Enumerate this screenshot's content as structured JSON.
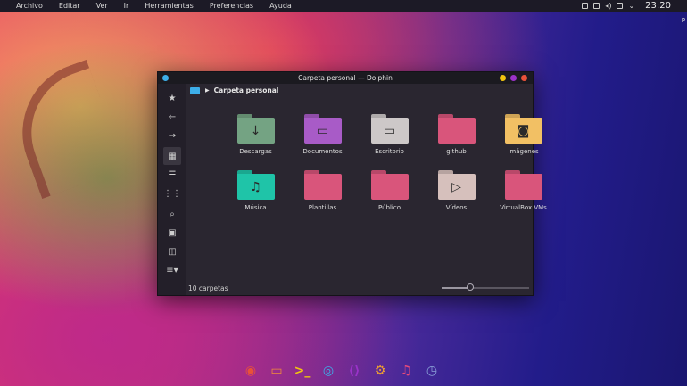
{
  "menubar": {
    "items": [
      "Archivo",
      "Editar",
      "Ver",
      "Ir",
      "Herramientas",
      "Preferencias",
      "Ayuda"
    ],
    "clock": "23:20"
  },
  "edge_text": "P",
  "window": {
    "title": "Carpeta personal — Dolphin",
    "controls": [
      {
        "name": "minimize",
        "color": "#f1c40f"
      },
      {
        "name": "maximize",
        "color": "#9b32c9"
      },
      {
        "name": "close",
        "color": "#e8513a"
      }
    ],
    "breadcrumb": "Carpeta personal",
    "sidebar": [
      {
        "name": "favorites",
        "glyph": "★"
      },
      {
        "name": "back",
        "glyph": "←"
      },
      {
        "name": "forward",
        "glyph": "→"
      },
      {
        "name": "icons-view",
        "glyph": "▦",
        "active": true
      },
      {
        "name": "compact-view",
        "glyph": "☰"
      },
      {
        "name": "details-view",
        "glyph": "⋮⋮"
      },
      {
        "name": "search",
        "glyph": "⌕"
      },
      {
        "name": "preview",
        "glyph": "▣"
      },
      {
        "name": "split",
        "glyph": "◫"
      },
      {
        "name": "menu",
        "glyph": "≡▾"
      }
    ],
    "folders": [
      {
        "label": "Descargas",
        "color": "#74a383",
        "glyph": "↓"
      },
      {
        "label": "Documentos",
        "color": "#a85bc7",
        "glyph": "▭"
      },
      {
        "label": "Escritorio",
        "color": "#cdc8c8",
        "glyph": "▭"
      },
      {
        "label": "github",
        "color": "#d9557b",
        "glyph": ""
      },
      {
        "label": "Imágenes",
        "color": "#f2c064",
        "glyph": "◙"
      },
      {
        "label": "Música",
        "color": "#1fc4a8",
        "glyph": "♫"
      },
      {
        "label": "Plantillas",
        "color": "#d9557b",
        "glyph": ""
      },
      {
        "label": "Público",
        "color": "#d9557b",
        "glyph": ""
      },
      {
        "label": "Vídeos",
        "color": "#d6c0bc",
        "glyph": "▷"
      },
      {
        "label": "VirtualBox VMs",
        "color": "#d9557b",
        "glyph": ""
      }
    ],
    "status": "10 carpetas",
    "zoom_fraction": 0.33
  },
  "dock": [
    {
      "name": "firefox-icon",
      "glyph": "◉",
      "color": "#e8513a"
    },
    {
      "name": "files-icon",
      "glyph": "▭",
      "color": "#f08a3a"
    },
    {
      "name": "terminal-icon",
      "glyph": ">_",
      "color": "#f1c40f"
    },
    {
      "name": "chrome-icon",
      "glyph": "◎",
      "color": "#3daee9"
    },
    {
      "name": "vscode-icon",
      "glyph": "⟨⟩",
      "color": "#9b32c9"
    },
    {
      "name": "settings-icon",
      "glyph": "⚙",
      "color": "#f0a030"
    },
    {
      "name": "music-icon",
      "glyph": "♫",
      "color": "#e84a7a"
    },
    {
      "name": "clock-icon",
      "glyph": "◷",
      "color": "#8aa0d8"
    }
  ]
}
